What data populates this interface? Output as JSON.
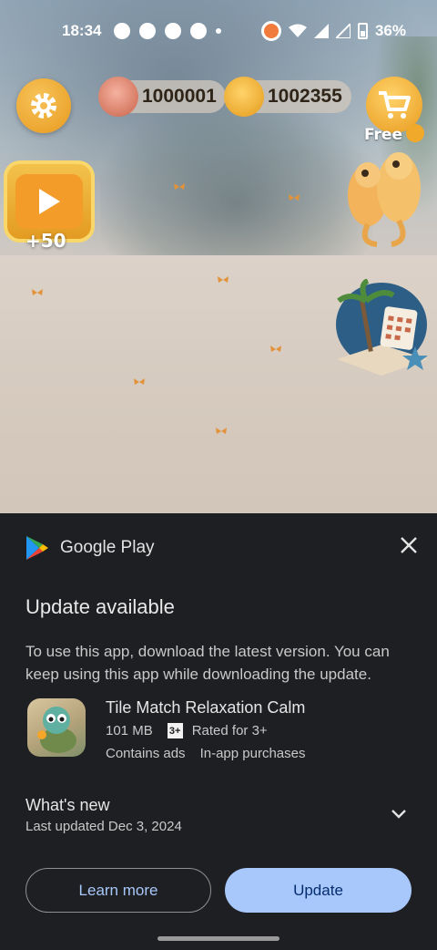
{
  "status_bar": {
    "time": "18:34",
    "battery": "36%"
  },
  "game": {
    "shells": "1000001",
    "coins": "1002355",
    "shop_free": "Free",
    "video_reward": "+50",
    "icons": [
      "settings-icon",
      "shell-icon",
      "coin-icon",
      "cart-icon",
      "play-icon",
      "seahorse-icon",
      "calendar-icon"
    ]
  },
  "sheet": {
    "brand": "Google Play",
    "title": "Update available",
    "description": "To use this app, download the latest version. You can keep using this app while downloading the update.",
    "app": {
      "name": "Tile Match Relaxation Calm",
      "size": "101 MB",
      "rating_badge": "3+",
      "rating_text": "Rated for 3+",
      "contains_ads": "Contains ads",
      "in_app": "In-app purchases"
    },
    "whats_new": {
      "title": "What's new",
      "last_updated": "Last updated Dec 3, 2024"
    },
    "buttons": {
      "learn_more": "Learn more",
      "update": "Update"
    }
  },
  "colors": {
    "sheet_bg": "#1e1f22",
    "accent": "#a8c7fa",
    "accent_text": "#062e6f"
  }
}
